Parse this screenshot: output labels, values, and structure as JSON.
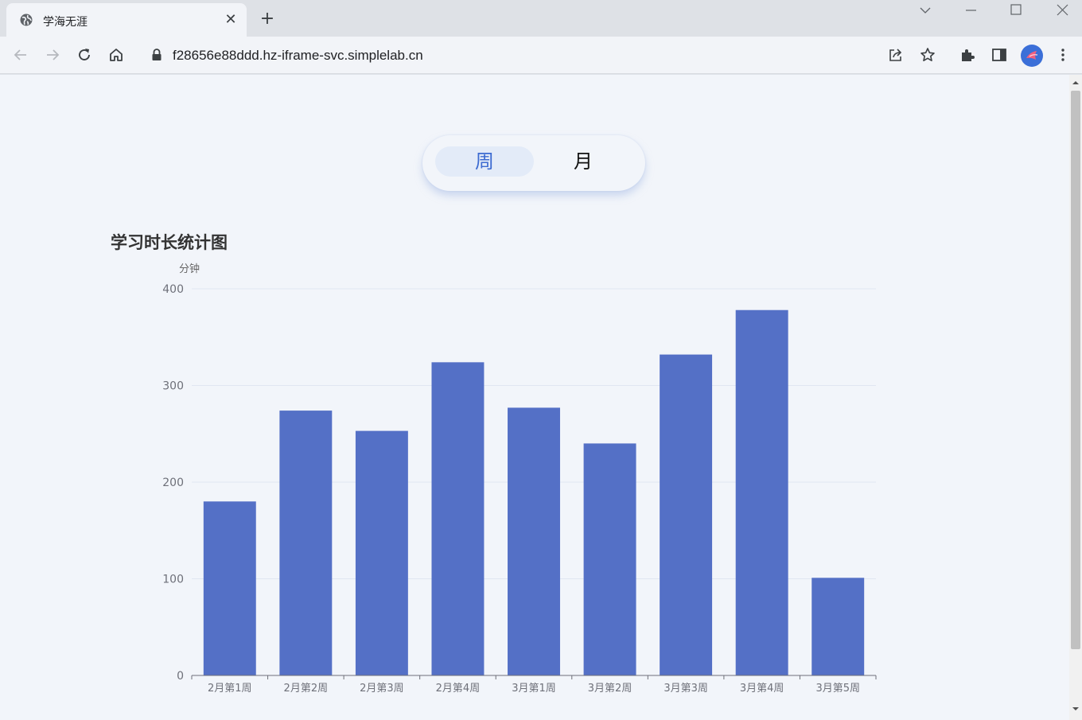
{
  "browser": {
    "tab_title": "学海无涯",
    "tab_close": "✕",
    "new_tab": "+",
    "url": "f28656e88ddd.hz-iframe-svc.simplelab.cn"
  },
  "toggle": {
    "week_label": "周",
    "month_label": "月",
    "active": "week"
  },
  "colors": {
    "bar": "#5470c6",
    "toggle_active_text": "#3d6bd1",
    "axis_text": "#6e7079",
    "grid": "#e0e6f1"
  },
  "chart_data": {
    "type": "bar",
    "title": "学习时长统计图",
    "ylabel": "分钟",
    "xlabel": "",
    "categories": [
      "2月第1周",
      "2月第2周",
      "2月第3周",
      "2月第4周",
      "3月第1周",
      "3月第2周",
      "3月第3周",
      "3月第4周",
      "3月第5周"
    ],
    "values": [
      180,
      274,
      253,
      324,
      277,
      240,
      332,
      378,
      101
    ],
    "ylim": [
      0,
      400
    ],
    "yticks": [
      0,
      100,
      200,
      300,
      400
    ],
    "grid": true,
    "legend": "none"
  }
}
